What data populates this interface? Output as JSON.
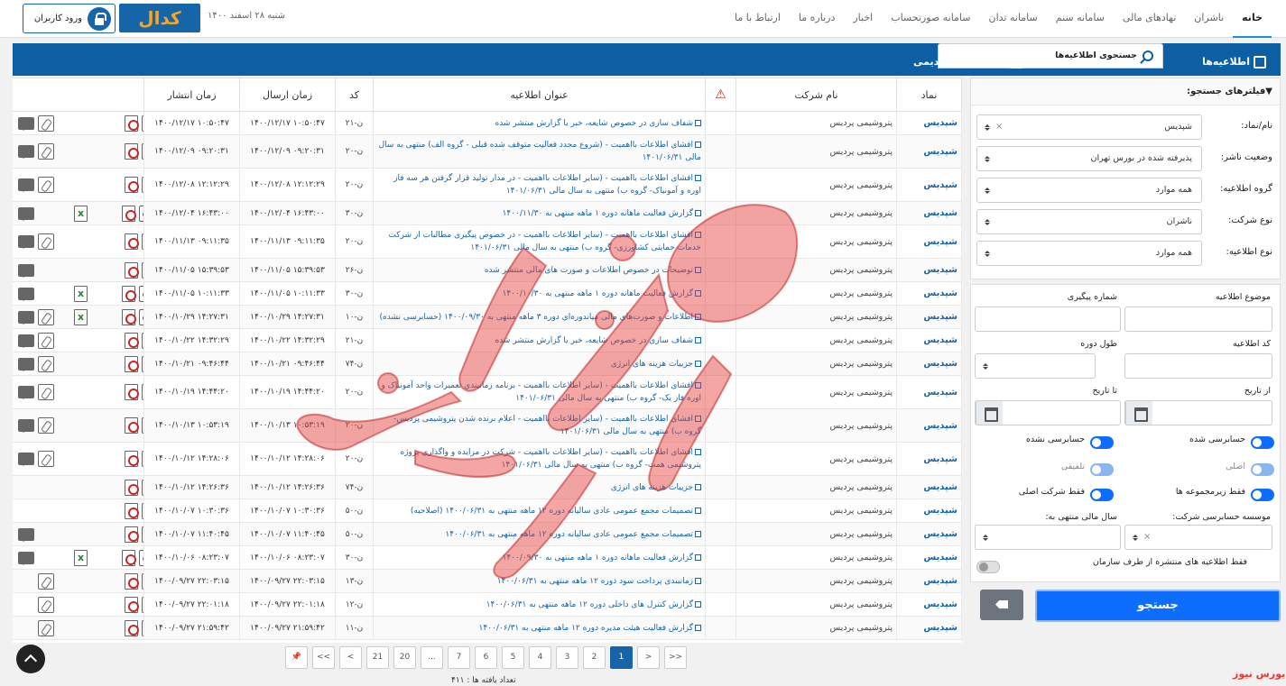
{
  "nav": {
    "items": [
      "خانه",
      "ناشران",
      "نهادهای مالی",
      "سامانه سنم",
      "سامانه تدان",
      "سامانه صورتحساب",
      "اخبار",
      "درباره ما",
      "ارتباط با ما"
    ],
    "date": "شنبه ۲۸ اسفند ۱۴۰۰",
    "logo": "کدال",
    "login": "ورود کاربران"
  },
  "tabs": {
    "announcements": "اطلاعیه‌ها",
    "search": "جستجوی اطلاعیه‌ها",
    "old": "اطلاعیه‌های قدیمی"
  },
  "table": {
    "headers": {
      "symbol": "نماد",
      "company": "نام شرکت",
      "title": "عنوان اطلاعیه",
      "code": "کد",
      "sent": "زمان ارسال",
      "published": "زمان انتشار"
    },
    "rows": [
      {
        "s": "شپدیس",
        "c": "پتروشیمی پردیس",
        "t": "شفاف سازی در خصوص شایعه، خبر یا گزارش منتشر شده",
        "k": "ن-۲۱",
        "a": "۱۴۰۰/۱۲/۱۷ ۱۰:۵۰:۴۷",
        "p": "۱۴۰۰/۱۲/۱۷ ۱۰:۵۰:۴۷",
        "icons": [
          "chat",
          "clip",
          "",
          "pdf",
          "eye"
        ]
      },
      {
        "s": "شپدیس",
        "c": "پتروشیمی پردیس",
        "t": "افشای اطلاعات بااهمیت - (شروع مجدد فعالیت متوقف شده قبلی - گروه الف) منتهی به سال مالی ۱۴۰۱/۰۶/۳۱",
        "k": "ن-۲۰",
        "a": "۱۴۰۰/۱۲/۰۹ ۰۹:۲۰:۳۱",
        "p": "۱۴۰۰/۱۲/۰۹ ۰۹:۲۰:۳۱",
        "icons": [
          "chat",
          "clip",
          "",
          "pdf",
          "eye"
        ]
      },
      {
        "s": "شپدیس",
        "c": "پتروشیمی پردیس",
        "t": "افشای اطلاعات بااهمیت - (سایر اطلاعات بااهمیت - در مدار تولید قرار گرفتن هر سه فاز اوره و آمونیاک- گروه ب) منتهی به سال مالی ۱۴۰۱/۰۶/۳۱",
        "k": "ن-۲۰",
        "a": "۱۴۰۰/۱۲/۰۸ ۱۲:۱۲:۲۹",
        "p": "۱۴۰۰/۱۲/۰۸ ۱۲:۱۲:۲۹",
        "icons": [
          "chat",
          "clip",
          "",
          "pdf",
          "eye"
        ]
      },
      {
        "s": "شپدیس",
        "c": "پتروشیمی پردیس",
        "t": "گزارش فعالیت ماهانه دوره ۱ ماهه منتهی به ۱۴۰۰/۱۱/۳۰",
        "k": "ن-۳۰",
        "a": "۱۴۰۰/۱۲/۰۴ ۱۶:۴۳:۰۰",
        "p": "۱۴۰۰/۱۲/۰۴ ۱۶:۴۳:۰۰",
        "icons": [
          "chat",
          "",
          "xls",
          "pdf",
          "eye"
        ]
      },
      {
        "s": "شپدیس",
        "c": "پتروشیمی پردیس",
        "t": "افشای اطلاعات بااهمیت - (سایر اطلاعات بااهمیت - در خصوص پیگیری مطالبات از شرکت خدمات حمایتی کشاورزی- گروه ب) منتهی به سال مالی ۱۴۰۱/۰۶/۳۱",
        "k": "ن-۲۰",
        "a": "۱۴۰۰/۱۱/۱۳ ۰۹:۱۱:۳۵",
        "p": "۱۴۰۰/۱۱/۱۳ ۰۹:۱۱:۳۵",
        "icons": [
          "chat",
          "clip",
          "",
          "pdf",
          "eye"
        ]
      },
      {
        "s": "شپدیس",
        "c": "پتروشیمی پردیس",
        "t": "توضیحات در خصوص اطلاعات و صورت های مالی منتشر شده",
        "k": "ن-۲۶",
        "a": "۱۴۰۰/۱۱/۰۵ ۱۵:۳۹:۵۳",
        "p": "۱۴۰۰/۱۱/۰۵ ۱۵:۳۹:۵۳",
        "icons": [
          "chat",
          "",
          "",
          "pdf",
          "eye"
        ]
      },
      {
        "s": "شپدیس",
        "c": "پتروشیمی پردیس",
        "t": "گزارش فعالیت ماهانه دوره ۱ ماهه منتهی به ۱۴۰۰/۱۰/۳۰",
        "k": "ن-۳۰",
        "a": "۱۴۰۰/۱۱/۰۵ ۱۰:۱۱:۳۳",
        "p": "۱۴۰۰/۱۱/۰۵ ۱۰:۱۱:۳۳",
        "icons": [
          "chat",
          "",
          "xls",
          "pdf",
          "eye"
        ]
      },
      {
        "s": "شپدیس",
        "c": "پتروشیمی پردیس",
        "t": "اطلاعات و صورت‌های مالی میاندوره‌ای دوره ۳ ماهه منتهی به ۱۴۰۰/۰۹/۳۰ (حسابرسی نشده)",
        "k": "ن-۱۰",
        "a": "۱۴۰۰/۱۰/۲۹ ۱۴:۲۷:۳۱",
        "p": "۱۴۰۰/۱۰/۲۹ ۱۴:۲۷:۳۱",
        "icons": [
          "chat",
          "clip",
          "xls",
          "pdf",
          "eye"
        ]
      },
      {
        "s": "شپدیس",
        "c": "پتروشیمی پردیس",
        "t": "شفاف سازی در خصوص شایعه، خبر یا گزارش منتشر شده",
        "k": "ن-۲۱",
        "a": "۱۴۰۰/۱۰/۲۲ ۱۴:۳۲:۲۹",
        "p": "۱۴۰۰/۱۰/۲۲ ۱۴:۳۲:۲۹",
        "icons": [
          "chat",
          "clip",
          "",
          "pdf",
          "eye"
        ]
      },
      {
        "s": "شپدیس",
        "c": "پتروشیمی پردیس",
        "t": "جزییات هزینه های انرژی",
        "k": "ن-۷۴",
        "a": "۱۴۰۰/۱۰/۲۱ ۰۹:۴۶:۴۴",
        "p": "۱۴۰۰/۱۰/۲۱ ۰۹:۴۶:۴۴",
        "icons": [
          "chat",
          "clip",
          "",
          "pdf",
          "eye"
        ]
      },
      {
        "s": "شپدیس",
        "c": "پتروشیمی پردیس",
        "t": "افشای اطلاعات بااهمیت - (سایر اطلاعات بااهمیت - برنامه زمانبندی تعمیرات واحد آمونیاک و اوره فاز یک- گروه ب) منتهی به سال مالی ۱۴۰۱/۰۶/۳۱",
        "k": "ن-۲۰",
        "a": "۱۴۰۰/۱۰/۱۹ ۱۴:۴۴:۲۰",
        "p": "۱۴۰۰/۱۰/۱۹ ۱۴:۴۴:۲۰",
        "icons": [
          "chat",
          "clip",
          "",
          "pdf",
          "eye"
        ]
      },
      {
        "s": "شپدیس",
        "c": "پتروشیمی پردیس",
        "t": "افشای اطلاعات بااهمیت - (سایر اطلاعات بااهمیت - اعلام برنده شدن پتروشیمی پردیس- گروه ب) منتهی به سال مالی ۱۴۰۱/۰۶/۳۱",
        "k": "ن-۲۰",
        "a": "۱۴۰۰/۱۰/۱۳ ۱۰:۵۳:۱۹",
        "p": "۱۴۰۰/۱۰/۱۳ ۱۰:۵۳:۱۹",
        "icons": [
          "chat",
          "clip",
          "",
          "pdf",
          "eye"
        ]
      },
      {
        "s": "شپدیس",
        "c": "پتروشیمی پردیس",
        "t": "افشای اطلاعات بااهمیت - (سایر اطلاعات بااهمیت - شرکت در مزایده و واگذاری پروژه پتروشیمی همت- گروه ب) منتهی به سال مالی ۱۴۰۱/۰۶/۳۱",
        "k": "ن-۲۰",
        "a": "۱۴۰۰/۱۰/۱۲ ۱۴:۲۸:۰۶",
        "p": "۱۴۰۰/۱۰/۱۲ ۱۴:۲۸:۰۶",
        "icons": [
          "chat",
          "clip",
          "",
          "pdf",
          "eye"
        ]
      },
      {
        "s": "شپدیس",
        "c": "پتروشیمی پردیس",
        "t": "جزییات هزینه های انرژی",
        "k": "ن-۷۴",
        "a": "۱۴۰۰/۱۰/۱۲ ۱۴:۲۶:۳۶",
        "p": "۱۴۰۰/۱۰/۱۲ ۱۴:۲۶:۳۶",
        "icons": [
          "",
          "",
          "",
          "pdf",
          "eye"
        ]
      },
      {
        "s": "شپدیس",
        "c": "پتروشیمی پردیس",
        "t": "تصمیمات مجمع عمومی عادی سالیانه دوره ۱۲ ماهه منتهی به ۱۴۰۰/۰۶/۳۱ (اصلاحیه)",
        "k": "ن-۵۰",
        "a": "۱۴۰۰/۱۰/۰۷ ۱۰:۳۰:۳۶",
        "p": "۱۴۰۰/۱۰/۰۷ ۱۰:۳۰:۳۶",
        "icons": [
          "",
          "",
          "",
          "pdf",
          "eye"
        ]
      },
      {
        "s": "شپدیس",
        "c": "پتروشیمی پردیس",
        "t": "تصمیمات مجمع عمومی عادی سالیانه دوره ۱۲ ماهه منتهی به ۱۴۰۰/۰۶/۳۱",
        "k": "ن-۵۰",
        "a": "۱۴۰۰/۱۰/۰۷ ۱۱:۴۰:۴۵",
        "p": "۱۴۰۰/۱۰/۰۷ ۱۱:۴۰:۴۵",
        "icons": [
          "chat",
          "",
          "",
          "pdf",
          "eye"
        ]
      },
      {
        "s": "شپدیس",
        "c": "پتروشیمی پردیس",
        "t": "گزارش فعالیت ماهانه دوره ۱ ماهه منتهی به ۱۴۰۰/۰۹/۳۰",
        "k": "ن-۳۰",
        "a": "۱۴۰۰/۱۰/۰۶ ۰۸:۲۳:۰۷",
        "p": "۱۴۰۰/۱۰/۰۶ ۰۸:۲۳:۰۷",
        "icons": [
          "chat",
          "",
          "xls",
          "pdf",
          "eye"
        ]
      },
      {
        "s": "شپدیس",
        "c": "پتروشیمی پردیس",
        "t": "زمانبندی پرداخت سود دوره ۱۲ ماهه منتهی به ۱۴۰۰/۰۶/۳۱",
        "k": "ن-۱۳",
        "a": "۱۴۰۰/۰۹/۲۷ ۲۲:۰۳:۱۵",
        "p": "۱۴۰۰/۰۹/۲۷ ۲۲:۰۳:۱۵",
        "icons": [
          "",
          "clip",
          "",
          "pdf",
          "eye"
        ]
      },
      {
        "s": "شپدیس",
        "c": "پتروشیمی پردیس",
        "t": "گزارش کنترل های داخلی دوره ۱۲ ماهه منتهی به ۱۴۰۰/۰۶/۳۱",
        "k": "ن-۱۲",
        "a": "۱۴۰۰/۰۹/۲۷ ۲۲:۰۱:۱۸",
        "p": "۱۴۰۰/۰۹/۲۷ ۲۲:۰۱:۱۸",
        "icons": [
          "",
          "clip",
          "",
          "pdf",
          "eye"
        ]
      },
      {
        "s": "شپدیس",
        "c": "پتروشیمی پردیس",
        "t": "گزارش فعالیت هیئت مدیره دوره ۱۲ ماهه منتهی به ۱۴۰۰/۰۶/۳۱",
        "k": "ن-۱۱",
        "a": "۱۴۰۰/۰۹/۲۷ ۲۱:۵۹:۴۲",
        "p": "۱۴۰۰/۰۹/۲۷ ۲۱:۵۹:۴۲",
        "icons": [
          "",
          "clip",
          "",
          "pdf",
          "eye"
        ]
      }
    ]
  },
  "pager": {
    "items": [
      ">>",
      ">",
      "1",
      "2",
      "3",
      "4",
      "5",
      "6",
      "7",
      "...",
      "20",
      "21",
      "<",
      "<<",
      "pin"
    ],
    "current": "1",
    "found": "تعداد یافته ها : ۴۱۱"
  },
  "filters": {
    "head": "فیلترهای جستجو:",
    "fields": [
      {
        "label": "نام/نماد:",
        "value": "شپدیس",
        "clearable": true
      },
      {
        "label": "وضعیت ناشر:",
        "value": "پذیرفته شده در بورس تهران"
      },
      {
        "label": "گروه اطلاعیه:",
        "value": "همه موارد"
      },
      {
        "label": "نوع شرکت:",
        "value": "ناشران"
      },
      {
        "label": "نوع اطلاعیه:",
        "value": "همه موارد"
      }
    ],
    "subject": "موضوع اطلاعیه",
    "tracking": "شماره پیگیری",
    "code": "کد اطلاعیه",
    "period": "طول دوره",
    "from": "از تاریخ",
    "to": "تا تاریخ",
    "audited": "حسابرسی شده",
    "unaudited": "حسابرسی نشده",
    "original": "اصلی",
    "combined": "تلفیقی",
    "subsidiaries": "فقط زیرمجموعه ها",
    "parent_only": "فقط شرکت اصلی",
    "auditor": "موسسه حسابرسی شرکت:",
    "fiscal_year": "سال مالی منتهی به:",
    "org_only": "فقط اطلاعیه های منتشره از طرف سازمان",
    "search_btn": "جستجو"
  },
  "watermark": {
    "corner": "بورس نیوز"
  },
  "colors": {
    "brand": "#0d5fa3",
    "accent": "#0d6efd",
    "link": "#1565a8",
    "watermark": "#e53935"
  }
}
